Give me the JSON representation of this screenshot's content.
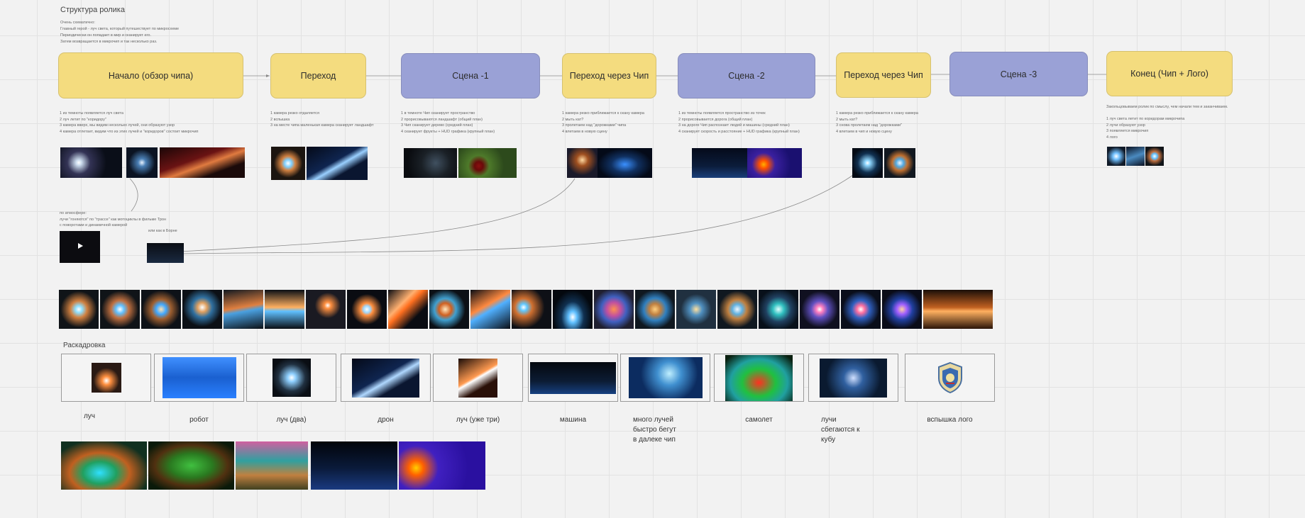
{
  "header": {
    "title": "Структура ролика",
    "intro": "Очень схематично:\nГлавный герой - луч света, который путешествует по микросхеме\nПериодически он попадает в мир и сканирует его.\nЗатем возвращается в микрочип и так несколько раз."
  },
  "nodes": [
    {
      "id": "start",
      "label": "Начало (обзор чипа)",
      "color": "yellow"
    },
    {
      "id": "transition",
      "label": "Переход",
      "color": "yellow"
    },
    {
      "id": "scene1",
      "label": "Сцена -1",
      "color": "purple"
    },
    {
      "id": "chip1",
      "label": "Переход через Чип",
      "color": "yellow"
    },
    {
      "id": "scene2",
      "label": "Сцена -2",
      "color": "purple"
    },
    {
      "id": "chip2",
      "label": "Переход через Чип",
      "color": "yellow"
    },
    {
      "id": "scene3",
      "label": "Сцена -3",
      "color": "purple"
    },
    {
      "id": "end",
      "label": "Конец (Чип + Лого)",
      "color": "yellow"
    }
  ],
  "notes": {
    "start": "1 из темноты появляется луч света\n2 луч летит по \"коридору\"\n3 камера вверх, мы видим несколько лучей, они образуют узор\n4 камера отлетает, видим что из этих лучей и \"коридоров\" состоит микрочип",
    "transition": "1 камера резко отдаляется\n2 вспышка\n3 на месте чипа маленькая камера сканирует ландшафт",
    "scene1": "1 в темноте Чип сканирует пространство\n2 прорисовываются ландшафт (общий план)\n3 Чип сканирует дерево (средний план)\n4 сканирует фрукты + HUD графика (крупный план)",
    "chip1": "1 камера резко приближается к скану камера\n2 мыть кат?\n3 пролетаем над \"дорожками\" чипа\n4 влетаем в новую сцену",
    "scene2": "1 из темноты появляется пространство из точек\n2 прорисовывается дорога (общий план)\n3 на дороге Чип распознает людей и машины (средний план)\n4 сканирует скорость и расстояние + HUD графика (крупный план)",
    "chip2": "1 камера резко приближается к скану камера\n2 мыть кат?\n3 снова пролетаем над \"дорожками\"\n4 влетаем в чип и новую сцену",
    "end": "Закольцовываем ролик по смыслу, чем начали тем и заканчиваем.\n\n1 луч света летит по коридорам микрочипа\n2 лучи образуют узор\n3 появляется микрочип\n4 лого"
  },
  "refs": {
    "atmosphere": "по атмосфере:\nлучи \"гоняются\" по \"трассе\" как мотоциклы в фильме Трон\nс поворотами и динамичной камерой",
    "like_born": "или как в Борне"
  },
  "storyboard": {
    "title": "Раскадровка",
    "frames": [
      {
        "caption": "луч",
        "icon": "light-beam-image"
      },
      {
        "caption": "робот",
        "icon": "robot-scan-image"
      },
      {
        "caption": "луч  (два)",
        "icon": "light-beam-image"
      },
      {
        "caption": "дрон",
        "icon": "drone-image"
      },
      {
        "caption": "луч (уже три)",
        "icon": "light-streaks-image"
      },
      {
        "caption": "машина",
        "icon": "city-points-image"
      },
      {
        "caption": "много лучей\nбыстро бегут\nв далеке чип",
        "icon": "chip-image"
      },
      {
        "caption": "самолет",
        "icon": "lidar-terrain-image"
      },
      {
        "caption": "лучи\nсбегаются к\nкубу",
        "icon": "circuit-cube-image"
      },
      {
        "caption": "вспышка лого",
        "icon": "logo-emblem"
      }
    ]
  },
  "colors": {
    "yellow": "#f4dc7f",
    "purple": "#9aa1d6",
    "bg": "#f2f2f2"
  }
}
